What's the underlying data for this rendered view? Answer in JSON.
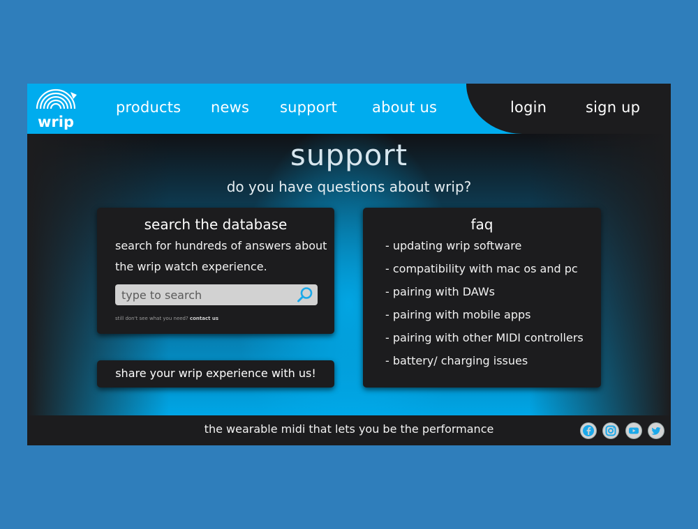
{
  "brand": {
    "logo_text": "wrip"
  },
  "nav": {
    "items": [
      {
        "label": "products"
      },
      {
        "label": "news"
      },
      {
        "label": "support"
      },
      {
        "label": "about us"
      }
    ],
    "login_label": "login",
    "signup_label": "sign up"
  },
  "page": {
    "title": "support",
    "subtitle": "do you have questions about wrip?"
  },
  "search_card": {
    "title": "search the database",
    "description_line1": "search for hundreds of answers about",
    "description_line2": "the wrip watch experience.",
    "search_placeholder": "type to search",
    "help_text": "still don't see what you need? ",
    "contact_link": "contact us"
  },
  "share_button": {
    "label": "share your wrip experience with us!"
  },
  "faq": {
    "title": "faq",
    "items": [
      "- updating wrip software",
      "- compatibility with mac os and pc",
      "- pairing with DAWs",
      "- pairing with mobile apps",
      "- pairing with other MIDI controllers",
      "- battery/ charging issues"
    ]
  },
  "footer": {
    "tagline": "the wearable midi that lets you be the performance",
    "social": [
      "facebook-icon",
      "instagram-icon",
      "youtube-icon",
      "twitter-icon"
    ]
  },
  "colors": {
    "page_bg": "#2f7ebb",
    "header_accent": "#00acee",
    "dark_panel": "#1c1c1e",
    "icon_blue": "#1ba9ea"
  }
}
